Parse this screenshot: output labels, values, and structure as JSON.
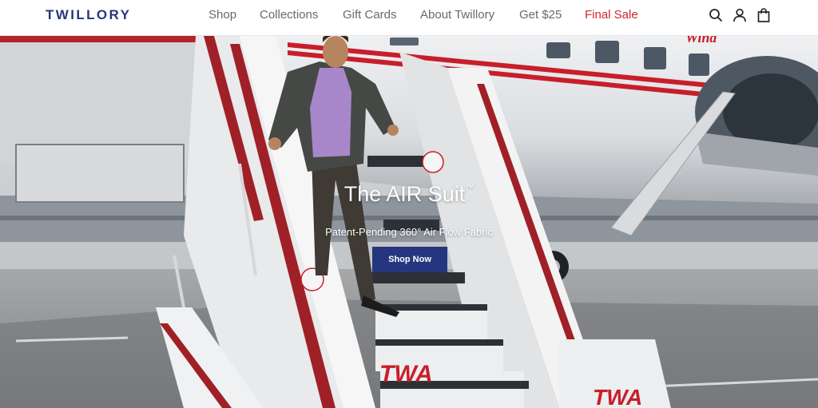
{
  "header": {
    "logo": "TWILLORY",
    "nav": [
      {
        "label": "Shop",
        "style": "normal"
      },
      {
        "label": "Collections",
        "style": "normal"
      },
      {
        "label": "Gift Cards",
        "style": "normal"
      },
      {
        "label": "About Twillory",
        "style": "normal"
      },
      {
        "label": "Get $25",
        "style": "normal"
      },
      {
        "label": "Final Sale",
        "style": "sale"
      }
    ],
    "icons": [
      "search-icon",
      "account-icon",
      "cart-icon"
    ]
  },
  "hero": {
    "title": "The AIR Suit",
    "title_mark": "™",
    "subtitle": "Patent-Pending 360° Air Flow Fabric",
    "button_label": "Shop Now",
    "stair_logo": "TWA",
    "fuselage_logo": "TWA",
    "fuselage_script": "Wind"
  },
  "colors": {
    "brand": "#26367e",
    "sale": "#d0272f",
    "nav_text": "#666a73",
    "twa_red": "#c81e2a"
  }
}
